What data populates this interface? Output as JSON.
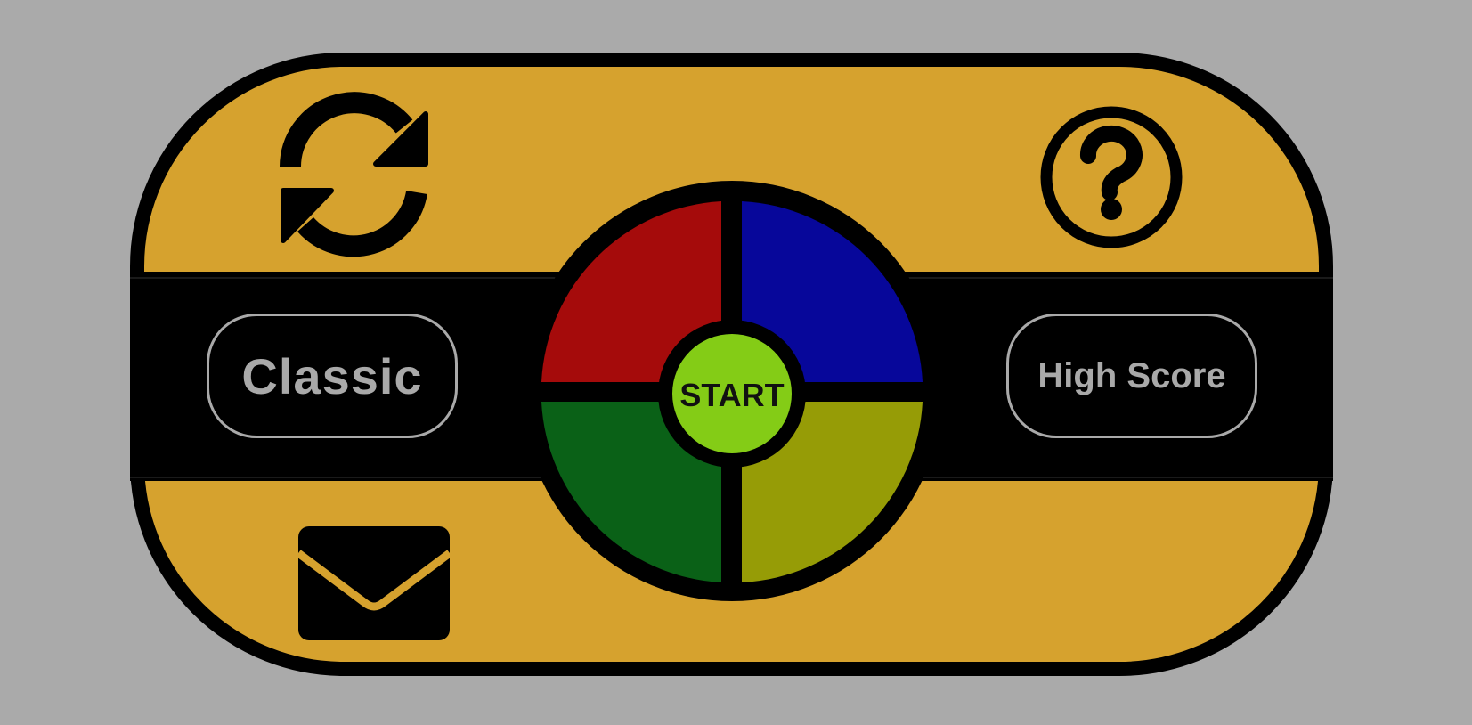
{
  "game": {
    "mode_label": "Classic",
    "highscore_label": "High Score",
    "start_label": "START"
  },
  "icons": {
    "restart": "refresh-icon",
    "help": "question-circle-icon",
    "contact": "envelope-icon"
  },
  "colors": {
    "background": "#aaaaaa",
    "frame": "#d6a22e",
    "band": "#000000",
    "pad_red": "#a50b0b",
    "pad_blue": "#07079a",
    "pad_green": "#0a6117",
    "pad_yellow": "#969c06",
    "start_button": "#84cc16",
    "button_outline": "#a9a9a9"
  }
}
